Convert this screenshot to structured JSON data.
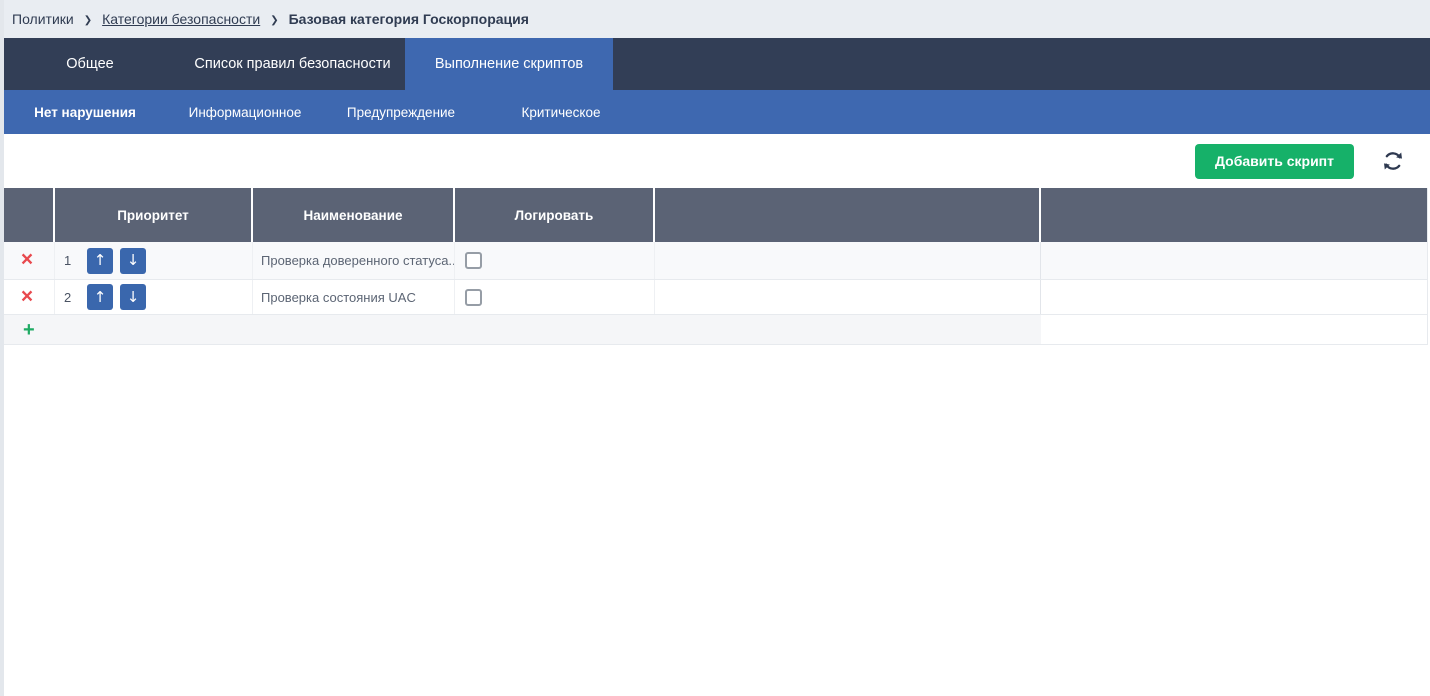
{
  "breadcrumb": {
    "separator": "❯",
    "items": [
      {
        "label": "Политики"
      },
      {
        "label": "Категории безопасности"
      },
      {
        "label": "Базовая категория Госкорпорация"
      }
    ]
  },
  "tabs": [
    {
      "label": "Общее",
      "active": false
    },
    {
      "label": "Список правил безопасности",
      "active": false
    },
    {
      "label": "Выполнение скриптов",
      "active": true
    }
  ],
  "subtabs": [
    {
      "label": "Нет нарушения",
      "active": true
    },
    {
      "label": "Информационное",
      "active": false
    },
    {
      "label": "Предупреждение",
      "active": false
    },
    {
      "label": "Критическое",
      "active": false
    }
  ],
  "toolbar": {
    "add_script_label": "Добавить скрипт",
    "refresh_icon": "refresh-arrows"
  },
  "icons": {
    "delete": "×",
    "move_up": "↑",
    "move_down": "↓",
    "add_row": "+"
  },
  "table": {
    "headers": {
      "actions": "",
      "priority": "Приоритет",
      "name": "Наименование",
      "log": "Логировать"
    },
    "rows": [
      {
        "priority": "1",
        "name": "Проверка доверенного статуса...",
        "log_checked": false
      },
      {
        "priority": "2",
        "name": "Проверка состояния UAC",
        "log_checked": false
      }
    ]
  },
  "colors": {
    "navy": "#323e56",
    "accent_blue": "#3e68b0",
    "header_slate": "#5b6375",
    "green": "#16b169",
    "red": "#e8494e",
    "move_button_blue": "#3a67ad"
  }
}
